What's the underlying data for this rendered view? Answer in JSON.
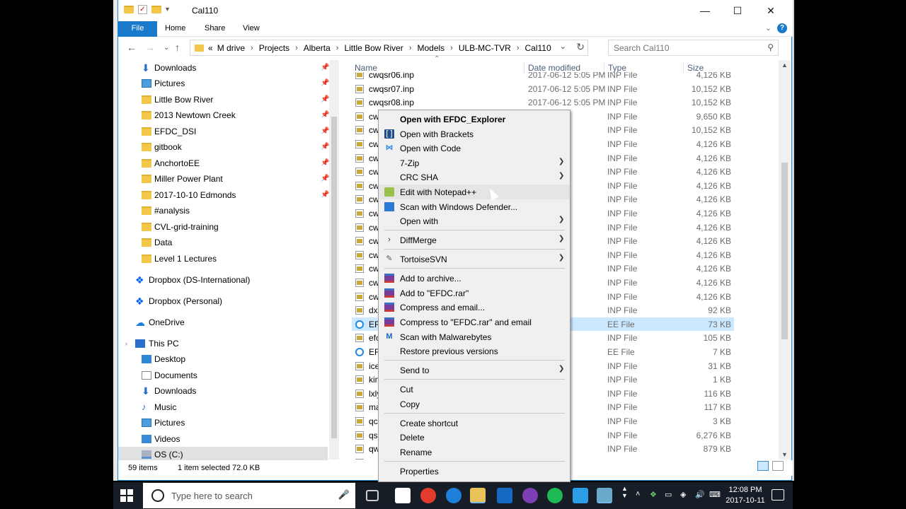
{
  "window": {
    "title": "Cal110",
    "minimize": "—",
    "maximize": "☐",
    "close": "✕"
  },
  "ribbon": {
    "tabs": [
      "File",
      "Home",
      "Share",
      "View"
    ]
  },
  "address": {
    "crumbs": [
      "«",
      "M drive",
      "Projects",
      "Alberta",
      "Little Bow River",
      "Models",
      "ULB-MC-TVR",
      "Cal110"
    ]
  },
  "search": {
    "placeholder": "Search Cal110"
  },
  "nav_pane": {
    "quick_access": [
      {
        "label": "Downloads",
        "icon": "download-icon"
      },
      {
        "label": "Pictures",
        "icon": "pictures-icon"
      },
      {
        "label": "Little Bow River",
        "icon": "folder-icon"
      },
      {
        "label": "2013 Newtown Creek",
        "icon": "folder-icon"
      },
      {
        "label": "EFDC_DSI",
        "icon": "folder-icon"
      },
      {
        "label": "gitbook",
        "icon": "folder-icon"
      },
      {
        "label": "AnchortoEE",
        "icon": "folder-icon"
      },
      {
        "label": "Miller Power Plant",
        "icon": "folder-icon"
      },
      {
        "label": "2017-10-10 Edmonds",
        "icon": "folder-icon"
      },
      {
        "label": "#analysis",
        "icon": "folder-icon"
      },
      {
        "label": "CVL-grid-training",
        "icon": "folder-icon"
      },
      {
        "label": "Data",
        "icon": "folder-icon"
      },
      {
        "label": "Level 1 Lectures",
        "icon": "folder-icon"
      }
    ],
    "dropbox_intl": "Dropbox (DS-International)",
    "dropbox_personal": "Dropbox (Personal)",
    "onedrive": "OneDrive",
    "this_pc": "This PC",
    "pc_items": [
      {
        "label": "Desktop",
        "icon": "desktop-icon"
      },
      {
        "label": "Documents",
        "icon": "documents-icon"
      },
      {
        "label": "Downloads",
        "icon": "download-icon"
      },
      {
        "label": "Music",
        "icon": "music-icon"
      },
      {
        "label": "Pictures",
        "icon": "pictures-icon"
      },
      {
        "label": "Videos",
        "icon": "videos-icon"
      },
      {
        "label": "OS (C:)",
        "icon": "drive-icon"
      }
    ]
  },
  "columns": {
    "name": "Name",
    "date": "Date modified",
    "type": "Type",
    "size": "Size"
  },
  "files": [
    {
      "name": "cwqsr06.inp",
      "date": "2017-06-12 5:05 PM",
      "type": "INP File",
      "size": "4,126 KB",
      "icon": "inp"
    },
    {
      "name": "cwqsr07.inp",
      "date": "2017-06-12 5:05 PM",
      "type": "INP File",
      "size": "10,152 KB",
      "icon": "inp"
    },
    {
      "name": "cwqsr08.inp",
      "date": "2017-06-12 5:05 PM",
      "type": "INP File",
      "size": "10,152 KB",
      "icon": "inp"
    },
    {
      "name": "cw",
      "date": "05 PM",
      "type": "INP File",
      "size": "9,650 KB",
      "icon": "inp"
    },
    {
      "name": "cw",
      "date": "05 PM",
      "type": "INP File",
      "size": "10,152 KB",
      "icon": "inp"
    },
    {
      "name": "cw",
      "date": "05 PM",
      "type": "INP File",
      "size": "4,126 KB",
      "icon": "inp"
    },
    {
      "name": "cw",
      "date": "05 PM",
      "type": "INP File",
      "size": "4,126 KB",
      "icon": "inp"
    },
    {
      "name": "cw",
      "date": "05 PM",
      "type": "INP File",
      "size": "4,126 KB",
      "icon": "inp"
    },
    {
      "name": "cw",
      "date": "05 PM",
      "type": "INP File",
      "size": "4,126 KB",
      "icon": "inp"
    },
    {
      "name": "cw",
      "date": "05 PM",
      "type": "INP File",
      "size": "4,126 KB",
      "icon": "inp"
    },
    {
      "name": "cw",
      "date": "05 PM",
      "type": "INP File",
      "size": "4,126 KB",
      "icon": "inp"
    },
    {
      "name": "cw",
      "date": "05 PM",
      "type": "INP File",
      "size": "4,126 KB",
      "icon": "inp"
    },
    {
      "name": "cw",
      "date": "05 PM",
      "type": "INP File",
      "size": "4,126 KB",
      "icon": "inp"
    },
    {
      "name": "cw",
      "date": "05 PM",
      "type": "INP File",
      "size": "4,126 KB",
      "icon": "inp"
    },
    {
      "name": "cw",
      "date": "05 PM",
      "type": "INP File",
      "size": "4,126 KB",
      "icon": "inp"
    },
    {
      "name": "cw",
      "date": "05 PM",
      "type": "INP File",
      "size": "4,126 KB",
      "icon": "inp"
    },
    {
      "name": "cw",
      "date": "05 PM",
      "type": "INP File",
      "size": "4,126 KB",
      "icon": "inp"
    },
    {
      "name": "dx",
      "date": "05 PM",
      "type": "INP File",
      "size": "92 KB",
      "icon": "inp"
    },
    {
      "name": "EF",
      "date": "05 PM",
      "type": "EE File",
      "size": "73 KB",
      "icon": "ee",
      "selected": true
    },
    {
      "name": "efc",
      "date": "05 PM",
      "type": "INP File",
      "size": "105 KB",
      "icon": "inp"
    },
    {
      "name": "EF",
      "date": "05 PM",
      "type": "EE File",
      "size": "7 KB",
      "icon": "ee"
    },
    {
      "name": "ice",
      "date": "05 PM",
      "type": "INP File",
      "size": "31 KB",
      "icon": "inp"
    },
    {
      "name": "kin",
      "date": "05 PM",
      "type": "INP File",
      "size": "1 KB",
      "icon": "inp"
    },
    {
      "name": "lxly",
      "date": "05 PM",
      "type": "INP File",
      "size": "116 KB",
      "icon": "inp"
    },
    {
      "name": "ma",
      "date": "02 PM",
      "type": "INP File",
      "size": "117 KB",
      "icon": "inp"
    },
    {
      "name": "qc",
      "date": "05 PM",
      "type": "INP File",
      "size": "3 KB",
      "icon": "inp"
    },
    {
      "name": "qs",
      "date": "05 PM",
      "type": "INP File",
      "size": "6,276 KB",
      "icon": "inp"
    },
    {
      "name": "qw",
      "date": "05 PM",
      "type": "INP File",
      "size": "879 KB",
      "icon": "inp"
    },
    {
      "name": "sg",
      "date": "05 PM",
      "type": "INP File",
      "size": "24 KB",
      "icon": "inp"
    }
  ],
  "status": {
    "count": "59 items",
    "selected": "1 item selected  72.0 KB"
  },
  "context_menu": [
    {
      "label": "Open with EFDC_Explorer",
      "bold": true
    },
    {
      "label": "Open with Brackets",
      "icon": "brackets-icon"
    },
    {
      "label": "Open with Code",
      "icon": "vscode-icon"
    },
    {
      "label": "7-Zip",
      "submenu": true
    },
    {
      "label": "CRC SHA",
      "submenu": true
    },
    {
      "label": "Edit with Notepad++",
      "icon": "notepadpp-icon",
      "hover": true
    },
    {
      "label": "Scan with Windows Defender...",
      "icon": "defender-icon"
    },
    {
      "label": "Open with",
      "submenu": true,
      "sep_after": true
    },
    {
      "label": "DiffMerge",
      "icon": "diffmerge-icon",
      "submenu": true,
      "sep_after": true
    },
    {
      "label": "TortoiseSVN",
      "icon": "tortoisesvn-icon",
      "submenu": true,
      "sep_after": true
    },
    {
      "label": "Add to archive...",
      "icon": "winrar-icon"
    },
    {
      "label": "Add to \"EFDC.rar\"",
      "icon": "winrar-icon"
    },
    {
      "label": "Compress and email...",
      "icon": "winrar-icon"
    },
    {
      "label": "Compress to \"EFDC.rar\" and email",
      "icon": "winrar-icon"
    },
    {
      "label": "Scan with Malwarebytes",
      "icon": "malwarebytes-icon"
    },
    {
      "label": "Restore previous versions",
      "sep_after": true
    },
    {
      "label": "Send to",
      "submenu": true,
      "sep_after": true
    },
    {
      "label": "Cut"
    },
    {
      "label": "Copy",
      "sep_after": true
    },
    {
      "label": "Create shortcut"
    },
    {
      "label": "Delete"
    },
    {
      "label": "Rename",
      "sep_after": true
    },
    {
      "label": "Properties"
    }
  ],
  "taskbar": {
    "search_placeholder": "Type here to search",
    "time": "12:08 PM",
    "date": "2017-10-11"
  },
  "colors": {
    "accent": "#1979ca",
    "selection": "#cce8ff",
    "taskbar": "#171d26"
  }
}
